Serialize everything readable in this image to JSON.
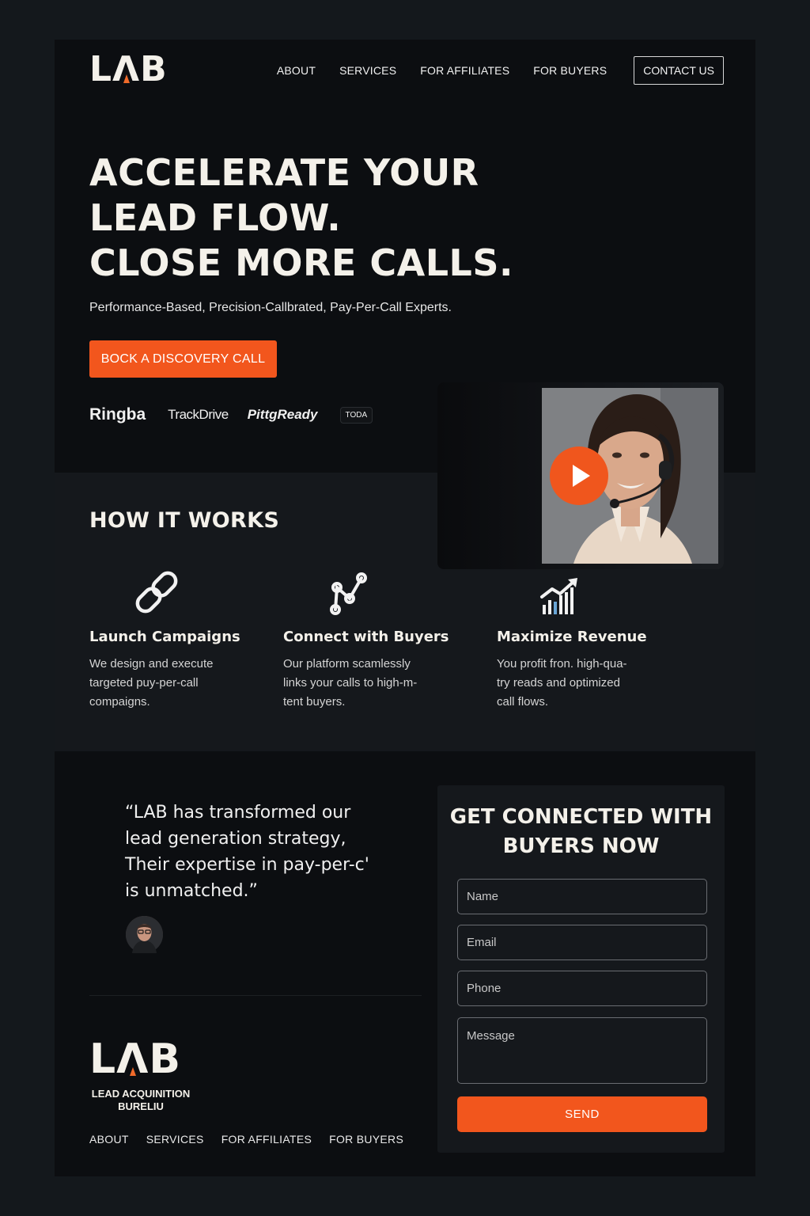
{
  "header": {
    "logo": {
      "l": "L",
      "a": "Λ",
      "b": "B"
    },
    "nav": [
      "ABOUT",
      "SERVICES",
      "FOR AFFILIATES",
      "FOR BUYERS"
    ],
    "contact_label": "CONTACT US"
  },
  "hero": {
    "title_lines": [
      "ACCELERATE YOUR",
      "LEAD FLOW.",
      "CLOSE MORE CALLS."
    ],
    "subtitle": "Performance-Based, Precision-Callbrated, Pay-Per-Call Experts.",
    "cta_label": "BOCK A DISCOVERY CALL",
    "partners": [
      "Ringba",
      "TrackDrive",
      "PittgReady",
      "TODA"
    ]
  },
  "how_it_works": {
    "title": "HOW IT WORKS",
    "steps": [
      {
        "icon": "chain-link-icon",
        "title": "Launch Campaigns",
        "lines": [
          "We design and execute",
          "targeted puy-per-call",
          "compaigns."
        ]
      },
      {
        "icon": "connection-nodes-icon",
        "title": "Connect with Buyers",
        "lines": [
          "Our platform scamlessly",
          "links your calls to high-m-",
          "tent buyers."
        ]
      },
      {
        "icon": "revenue-chart-icon",
        "title": "Maximize Revenue",
        "lines": [
          "You profit fron. high-qua-",
          "try reads and optimized",
          "call flows."
        ]
      }
    ]
  },
  "testimonial": {
    "lines": [
      "“LAB has transformed our",
      "lead generation strategy,",
      "Their expertise in pay-per-c'",
      "is unmatched.”"
    ]
  },
  "footer": {
    "logo_sub_1": "LEAD ACQUINITION",
    "logo_sub_2": "BURELIU",
    "nav": [
      "ABOUT",
      "SERVICES",
      "FOR AFFILIATES",
      "FOR BUYERS"
    ]
  },
  "form": {
    "title_line_1": "GET CONNECTED WITH",
    "title_line_2": "BUYERS NOW",
    "name_placeholder": "Name",
    "email_placeholder": "Email",
    "phone_placeholder": "Phone",
    "message_placeholder": "Message",
    "send_label": "SEND"
  },
  "colors": {
    "accent": "#f2561d",
    "background": "#0c0e11",
    "band": "#15181c"
  }
}
